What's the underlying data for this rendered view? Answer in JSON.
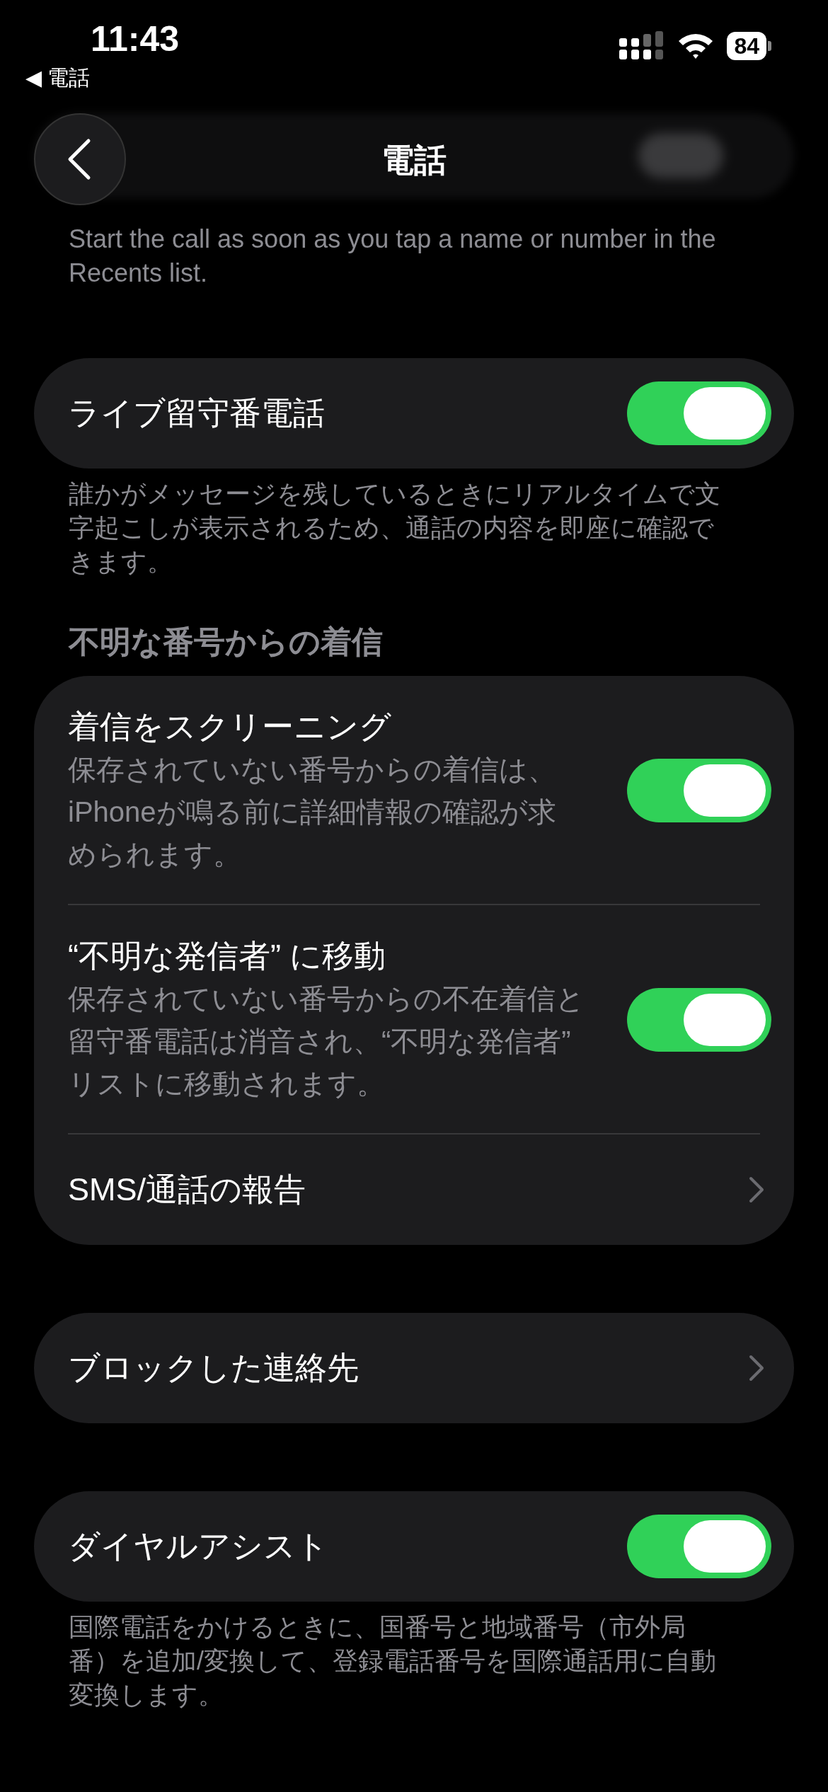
{
  "status_bar": {
    "time": "11:43",
    "back_app": "◀ 電話",
    "battery": "84"
  },
  "nav": {
    "title": "電話"
  },
  "top_footer": "Start the call as soon as you tap a name or number in the Recents list.",
  "groups": [
    {
      "rows": [
        {
          "kind": "toggle",
          "title": "ライブ留守番電話",
          "on": true
        }
      ],
      "footer": "誰かがメッセージを残しているときにリアルタイムで文字起こしが表示されるため、通話の内容を即座に確認できます。"
    },
    {
      "header": "不明な番号からの着信",
      "rows": [
        {
          "kind": "toggle",
          "title": "着信をスクリーニング",
          "subtitle": "保存されていない番号からの着信は、iPhoneが鳴る前に詳細情報の確認が求められます。",
          "on": true
        },
        {
          "kind": "toggle",
          "title": "“不明な発信者” に移動",
          "subtitle": "保存されていない番号からの不在着信と留守番電話は消音され、“不明な発信者” リストに移動されます。",
          "on": true
        },
        {
          "kind": "link",
          "title": "SMS/通話の報告"
        }
      ]
    },
    {
      "rows": [
        {
          "kind": "link",
          "title": "ブロックした連絡先"
        }
      ]
    },
    {
      "rows": [
        {
          "kind": "toggle",
          "title": "ダイヤルアシスト",
          "on": true
        }
      ],
      "footer": "国際電話をかけるときに、国番号と地域番号（市外局番）を追加/変換して、登録電話番号を国際通話用に自動変換します。"
    }
  ]
}
